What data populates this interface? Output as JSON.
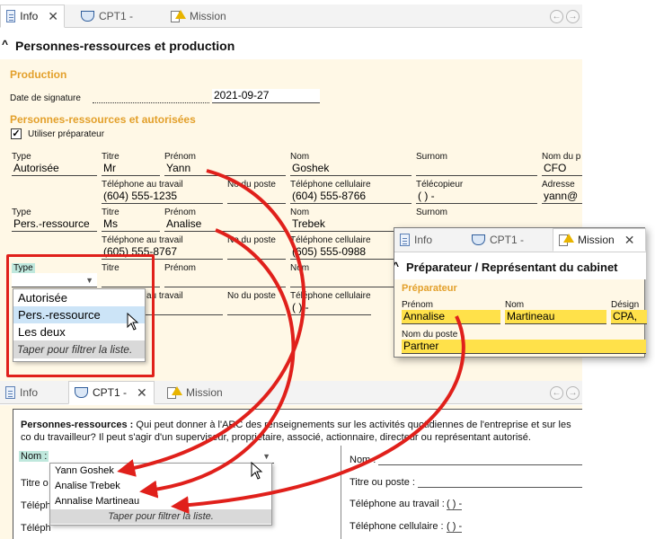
{
  "main": {
    "tabs": [
      {
        "label": "Info",
        "icon": "document-icon",
        "active": true
      },
      {
        "label": "CPT1 -",
        "icon": "shield-icon"
      },
      {
        "label": "Mission",
        "icon": "warning-icon"
      }
    ],
    "close_glyph": "✕",
    "nav_back": "←",
    "nav_forward": "→",
    "section_title": "Personnes-ressources et production",
    "production_heading": "Production",
    "signature_date_label": "Date de signature",
    "signature_date_value": "2021-09-27",
    "contacts_heading": "Personnes-ressources et autorisées",
    "use_preparer_label": "Utiliser préparateur",
    "use_preparer_checked": "✓",
    "col_labels": {
      "type": "Type",
      "titre": "Titre",
      "prenom": "Prénom",
      "nom": "Nom",
      "surnom": "Surnom",
      "nom_du": "Nom du p",
      "tel_travail": "Téléphone au travail",
      "no_poste": "No du poste",
      "tel_cell": "Téléphone cellulaire",
      "telecopieur": "Télécopieur",
      "adresse": "Adresse"
    },
    "row1": {
      "type": "Autorisée",
      "titre": "Mr",
      "prenom": "Yann",
      "nom": "Goshek",
      "nom_du": "CFO",
      "tel_travail": "(604) 555-1235",
      "tel_cell": "(604) 555-8766",
      "telecopieur": "(      )      -",
      "adresse": "yann@"
    },
    "row2": {
      "type": "Pers.-ressource",
      "titre": "Ms",
      "prenom": "Analise",
      "nom": "Trebek",
      "tel_travail": "(605) 555-8767",
      "tel_cell": "(605) 555-0988"
    },
    "row3": {
      "tel_cell": "(      )      -",
      "partial_label_au_travail": "au travail",
      "partial_label_nom": "Nom"
    },
    "type_dropdown": {
      "arrow": "▼",
      "options": [
        "Autorisée",
        "Pers.-ressource",
        "Les deux"
      ],
      "highlighted_index": 1,
      "filter_hint": "Taper pour filtrer la liste."
    }
  },
  "mission_callout": {
    "tabs": [
      {
        "label": "Info"
      },
      {
        "label": "CPT1 -"
      },
      {
        "label": "Mission",
        "active": true
      }
    ],
    "close_glyph": "✕",
    "section_title": "Préparateur / Représentant du cabinet",
    "subheading": "Préparateur",
    "prenom_label": "Prénom",
    "prenom_value": "Annalise",
    "nom_label": "Nom",
    "nom_value": "Martineau",
    "design_label": "Désign",
    "design_value": "CPA,",
    "poste_label": "Nom du poste",
    "poste_value": "Partner"
  },
  "cpt1": {
    "tabs": [
      {
        "label": "Info"
      },
      {
        "label": "CPT1 -",
        "active": true
      },
      {
        "label": "Mission"
      }
    ],
    "close_glyph": "✕",
    "intro_bold": "Personnes-ressources :",
    "intro_text": "Qui peut donner à l'ARC des renseignements sur les activités quotidiennes de l'entreprise et sur les co du travailleur? Il peut s'agir d'un superviseur, propriétaire, associé, actionnaire, directeur ou représentant autorisé.",
    "nom_label": "Nom :",
    "titre_label": "Titre o",
    "telephone_label": "Téléph",
    "telephone_label2": "Téléph",
    "right_nom_label": "Nom :",
    "right_titre_label": "Titre ou poste :",
    "right_tel_travail_label": "Téléphone au travail :",
    "right_tel_travail_value": "(       )       -",
    "right_tel_cell_label": "Téléphone cellulaire :",
    "right_tel_cell_value": "(       )       -",
    "name_dropdown": {
      "arrow": "▼",
      "options": [
        "Yann Goshek",
        "Analise Trebek",
        "Annalise Martineau"
      ],
      "filter_hint": "Taper pour filtrer la liste."
    }
  },
  "colors": {
    "form_bg": "#fff8e6",
    "orange_heading": "#e3a02b",
    "highlight_yellow": "#ffe14a",
    "annotation_red": "#e0201b",
    "list_highlight": "#cce4f7",
    "type_label_bg": "#bfe8dd"
  }
}
